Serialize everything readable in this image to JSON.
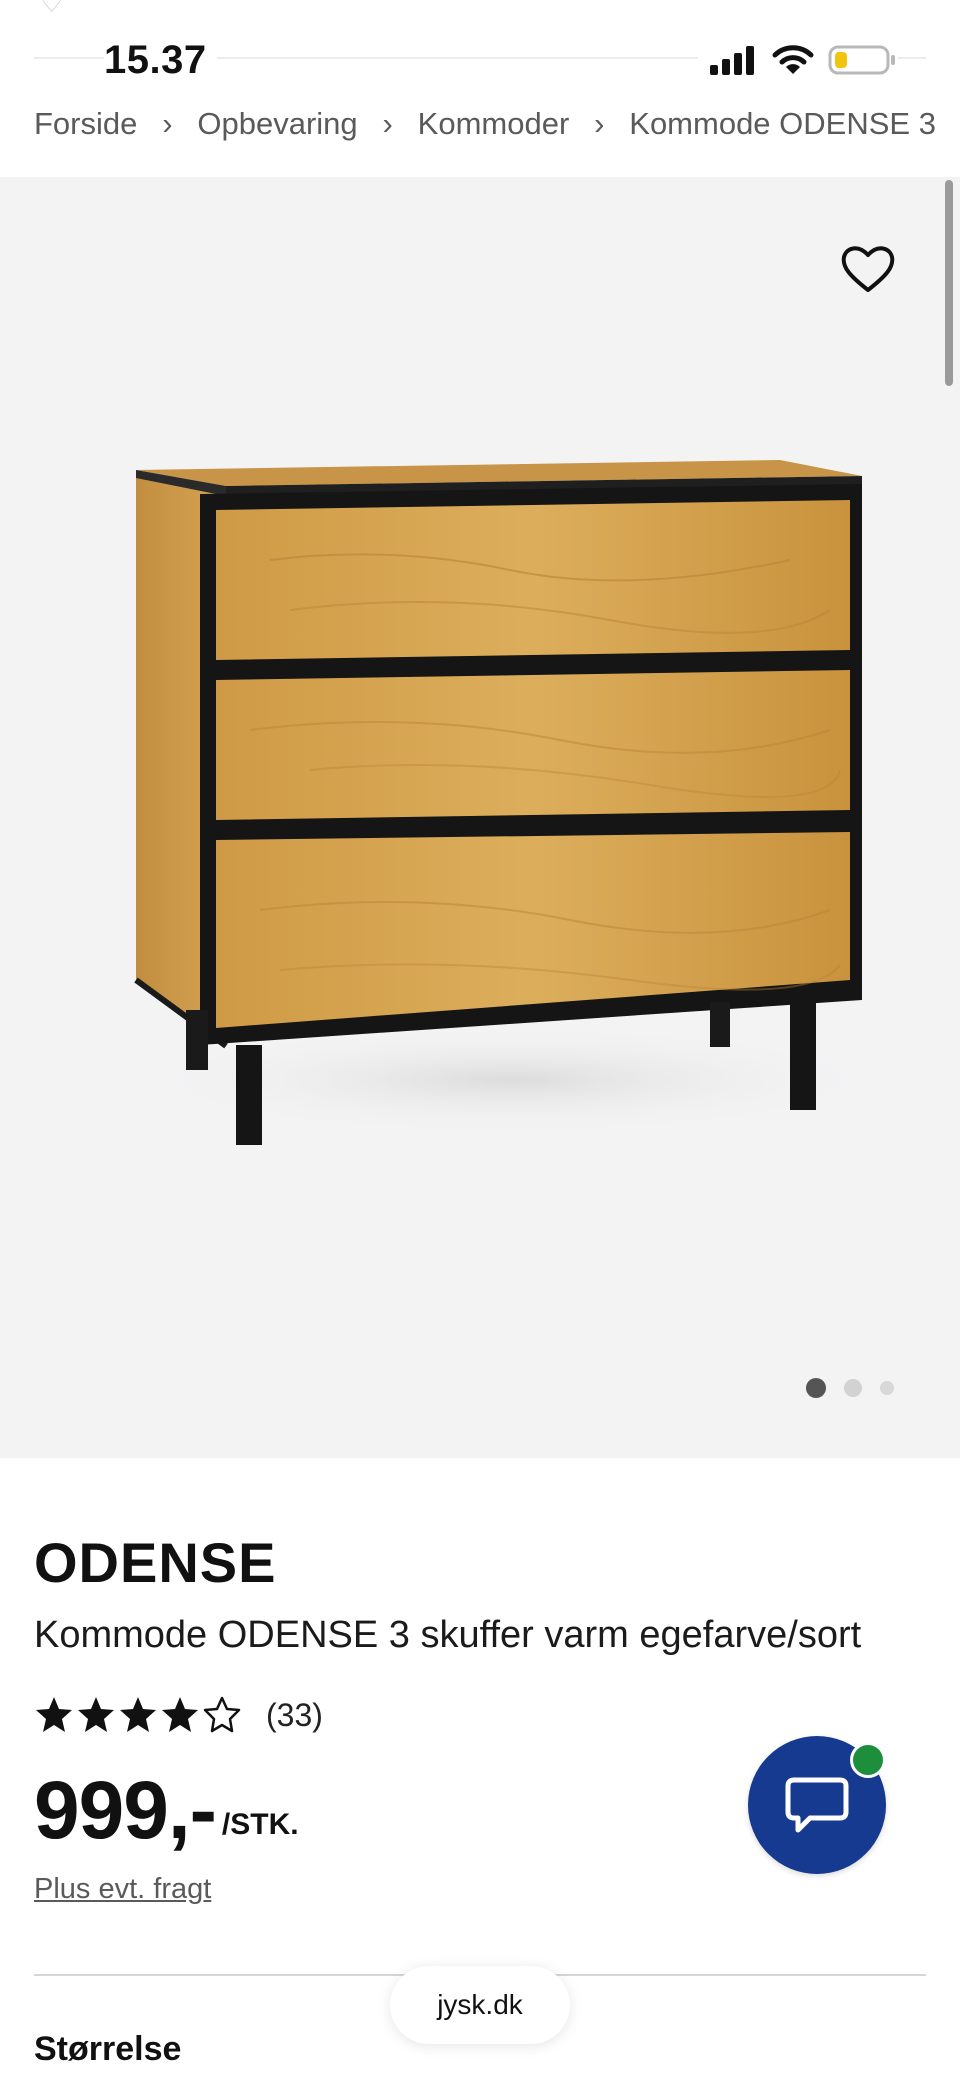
{
  "status_bar": {
    "time": "15.37"
  },
  "breadcrumb": {
    "items": [
      "Forside",
      "Opbevaring",
      "Kommoder",
      "Kommode ODENSE 3"
    ]
  },
  "gallery": {
    "wishlist_icon": "heart-outline-icon",
    "dots_total": 3,
    "active_dot": 0
  },
  "product": {
    "brand": "ODENSE",
    "name": "Kommode ODENSE 3 skuffer varm egefarve/sort",
    "rating": {
      "stars": 4,
      "max": 5,
      "count_label": "(33)"
    },
    "price": {
      "amount": "999,-",
      "unit": "/STK."
    },
    "shipping_link": "Plus evt. fragt"
  },
  "chat": {
    "icon": "chat-bubble-icon",
    "badge_color": "#1d8f3c",
    "button_color": "#163a8f"
  },
  "browser": {
    "url": "jysk.dk"
  },
  "sections": {
    "size_title": "Størrelse"
  }
}
